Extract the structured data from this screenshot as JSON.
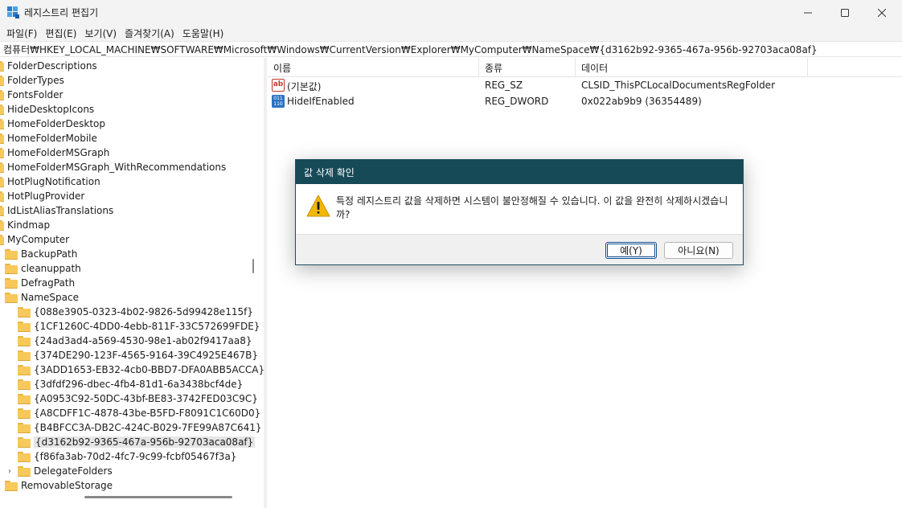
{
  "window": {
    "title": "레지스트리 편집기",
    "controls": {
      "minimize_icon": "minimize-icon",
      "maximize_icon": "maximize-icon",
      "close_icon": "close-icon"
    }
  },
  "menu": [
    "파일(F)",
    "편집(E)",
    "보기(V)",
    "즐겨찾기(A)",
    "도움말(H)"
  ],
  "address": "컴퓨터₩HKEY_LOCAL_MACHINE₩SOFTWARE₩Microsoft₩Windows₩CurrentVersion₩Explorer₩MyComputer₩NameSpace₩{d3162b92-9365-467a-956b-92703aca08af}",
  "tree": {
    "items": [
      "FolderDescriptions",
      "FolderTypes",
      "FontsFolder",
      "HideDesktopIcons",
      "HomeFolderDesktop",
      "HomeFolderMobile",
      "HomeFolderMSGraph",
      "HomeFolderMSGraph_WithRecommendations",
      "HotPlugNotification",
      "HotPlugProvider",
      "IdListAliasTranslations",
      "Kindmap",
      "MyComputer",
      "BackupPath",
      "cleanuppath",
      "DefragPath",
      "NameSpace",
      "{088e3905-0323-4b02-9826-5d99428e115f}",
      "{1CF1260C-4DD0-4ebb-811F-33C572699FDE}",
      "{24ad3ad4-a569-4530-98e1-ab02f9417aa8}",
      "{374DE290-123F-4565-9164-39C4925E467B}",
      "{3ADD1653-EB32-4cb0-BBD7-DFA0ABB5ACCA}",
      "{3dfdf296-dbec-4fb4-81d1-6a3438bcf4de}",
      "{A0953C92-50DC-43bf-BE83-3742FED03C9C}",
      "{A8CDFF1C-4878-43be-B5FD-F8091C1C60D0}",
      "{B4BFCC3A-DB2C-424C-B029-7FE99A87C641}",
      "{d3162b92-9365-467a-956b-92703aca08af}",
      "{f86fa3ab-70d2-4fc7-9c99-fcbf05467f3a}",
      "DelegateFolders",
      "RemovableStorage"
    ],
    "selected": "{d3162b92-9365-467a-956b-92703aca08af}"
  },
  "values_list": {
    "columns": [
      "이름",
      "종류",
      "데이터"
    ],
    "rows": [
      {
        "name": "(기본값)",
        "type": "REG_SZ",
        "data": "CLSID_ThisPCLocalDocumentsRegFolder",
        "icon": "string-value-icon"
      },
      {
        "name": "HideIfEnabled",
        "type": "REG_DWORD",
        "data": "0x022ab9b9 (36354489)",
        "icon": "binary-value-icon"
      }
    ]
  },
  "dialog": {
    "title": "값 삭제 확인",
    "message": "특정 레지스트리 값을 삭제하면 시스템이 불안정해질 수 있습니다. 이 값을 완전히 삭제하시겠습니까?",
    "icon": "warning-icon",
    "yes_label": "예(Y)",
    "no_label": "아니요(N)"
  },
  "colors": {
    "dialog_title_bg": "#174a57",
    "folder": "#f7c95a",
    "warning": "#f2b705"
  }
}
